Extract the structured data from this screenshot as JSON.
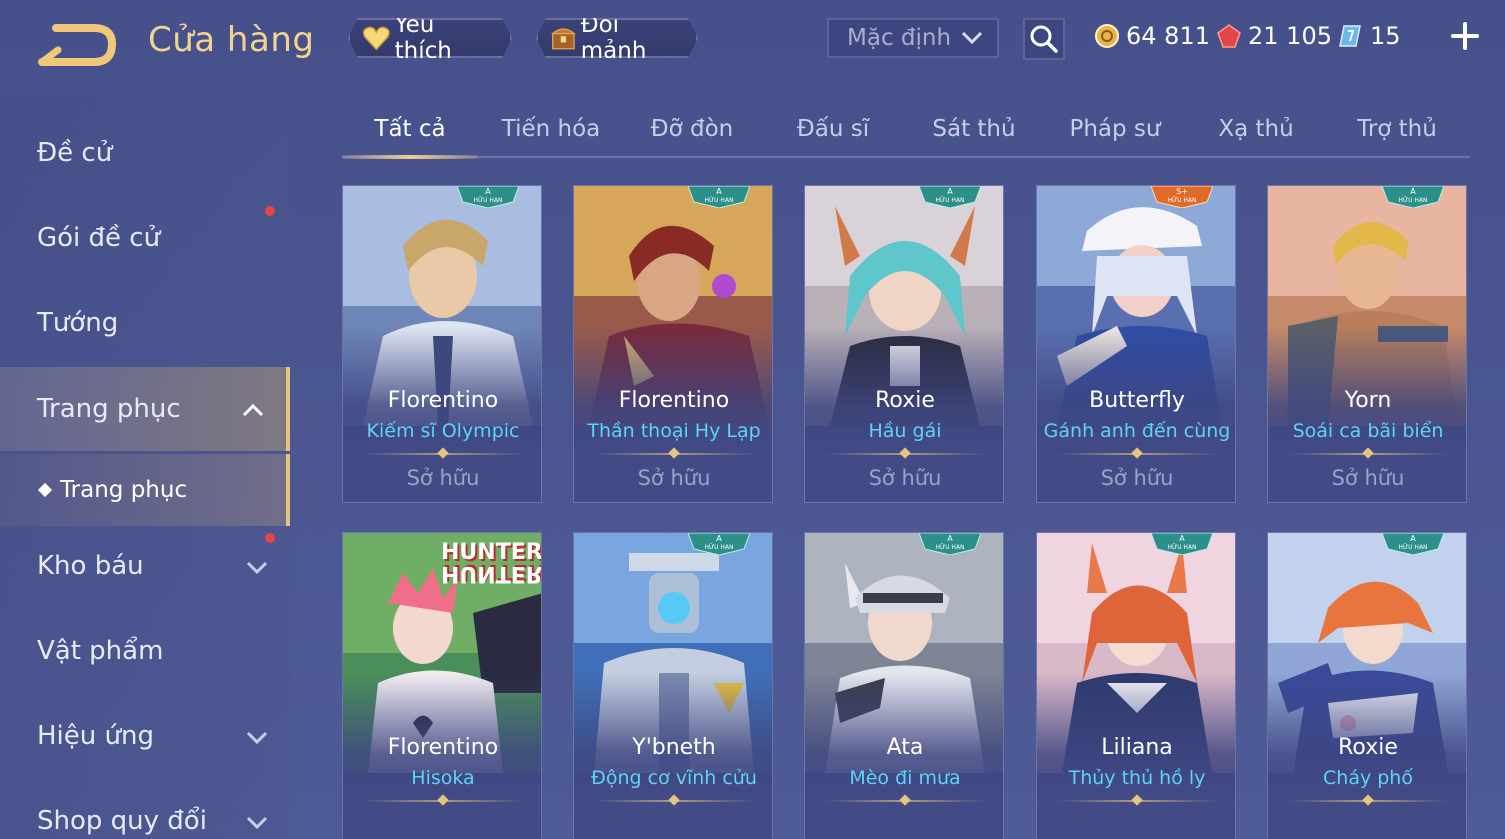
{
  "header": {
    "title": "Cửa hàng",
    "favorite_label": "Yêu thích",
    "exchange_label": "Đổi mảnh",
    "sort_value": "Mặc định",
    "currencies": [
      {
        "name": "gold",
        "value": "64 811"
      },
      {
        "name": "ruby",
        "value": "21 105"
      },
      {
        "name": "voucher",
        "value": "15"
      }
    ]
  },
  "sidebar": {
    "items": [
      {
        "label": "Đề cử"
      },
      {
        "label": "Gói đề cử",
        "dot": true
      },
      {
        "label": "Tướng"
      },
      {
        "label": "Trang phục",
        "active": true,
        "expanded": true
      },
      {
        "label": "Kho báu",
        "dot": true
      },
      {
        "label": "Vật phẩm"
      },
      {
        "label": "Hiệu ứng"
      },
      {
        "label": "Shop quy đổi"
      }
    ],
    "sub_item": "Trang phục"
  },
  "tabs": [
    "Tất cả",
    "Tiến hóa",
    "Đỡ đòn",
    "Đấu sĩ",
    "Sát thủ",
    "Pháp sư",
    "Xạ thủ",
    "Trợ thủ"
  ],
  "active_tab": "Tất cả",
  "cards": [
    {
      "hero": "Florentino",
      "skin": "Kiếm sĩ Olympic",
      "status": "Sở hữu",
      "badge": "A"
    },
    {
      "hero": "Florentino",
      "skin": "Thần thoại Hy Lạp",
      "status": "Sở hữu",
      "badge": "A"
    },
    {
      "hero": "Roxie",
      "skin": "Hầu gái",
      "status": "Sở hữu",
      "badge": "A"
    },
    {
      "hero": "Butterfly",
      "skin": "Gánh anh đến cùng",
      "status": "Sở hữu",
      "badge": "S+"
    },
    {
      "hero": "Yorn",
      "skin": "Soái ca bãi biển",
      "status": "Sở hữu",
      "badge": "A"
    },
    {
      "hero": "Florentino",
      "skin": "Hisoka",
      "status": "",
      "badge": "",
      "logo": "HUNTER"
    },
    {
      "hero": "Y'bneth",
      "skin": "Động cơ vĩnh cửu",
      "status": "",
      "badge": "A"
    },
    {
      "hero": "Ata",
      "skin": "Mèo đi mưa",
      "status": "",
      "badge": "A"
    },
    {
      "hero": "Liliana",
      "skin": "Thủy thủ hồ ly",
      "status": "",
      "badge": "A"
    },
    {
      "hero": "Roxie",
      "skin": "Cháy phố",
      "status": "",
      "badge": "A"
    }
  ],
  "badge_caption": "HỮU HẠN",
  "colors": {
    "accent_gold": "#f3d48f",
    "skin_name": "#5fd3f5",
    "background": "#4a5590",
    "notification": "#e84545"
  }
}
